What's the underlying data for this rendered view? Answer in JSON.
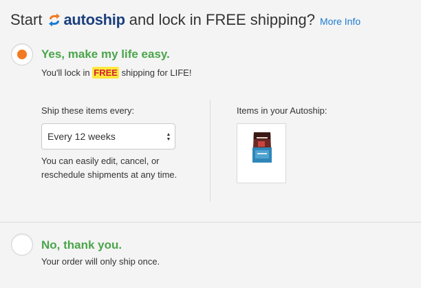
{
  "header": {
    "prefix": "Start",
    "brand": "autoship",
    "suffix": "and lock in FREE shipping?",
    "more_info": "More Info"
  },
  "option_yes": {
    "title": "Yes, make my life easy.",
    "sub_before": "You'll lock in",
    "badge": "FREE",
    "sub_after": "shipping for LIFE!",
    "selected": true
  },
  "frequency": {
    "label": "Ship these items every:",
    "selected": "Every 12 weeks",
    "help": "You can easily edit, cancel, or reschedule shipments at any time."
  },
  "items": {
    "label": "Items in your Autoship:",
    "product_icon": "dog-food-bag-icon"
  },
  "option_no": {
    "title": "No, thank you.",
    "sub": "Your order will only ship once.",
    "selected": false
  },
  "colors": {
    "accent_orange": "#f27a22",
    "green": "#4aa54a",
    "link_blue": "#1c7bd4",
    "brand_navy": "#1b3f7e",
    "badge_yellow": "#ffe83d",
    "badge_red": "#d0202e"
  }
}
